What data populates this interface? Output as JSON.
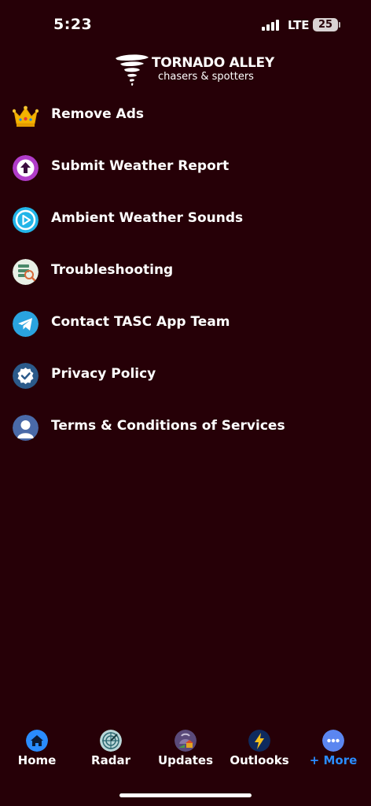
{
  "status_bar": {
    "time": "5:23",
    "network": "LTE",
    "battery": "25"
  },
  "logo": {
    "title": "TORNADO ALLEY",
    "subtitle": "chasers & spotters"
  },
  "menu": {
    "items": [
      {
        "label": "Remove Ads",
        "icon": "crown-icon"
      },
      {
        "label": "Submit Weather Report",
        "icon": "upload-arrow-icon"
      },
      {
        "label": "Ambient Weather Sounds",
        "icon": "play-icon"
      },
      {
        "label": "Troubleshooting",
        "icon": "troubleshoot-icon"
      },
      {
        "label": "Contact TASC App Team",
        "icon": "telegram-icon"
      },
      {
        "label": "Privacy Policy",
        "icon": "verified-check-icon"
      },
      {
        "label": "Terms & Conditions of Services",
        "icon": "user-icon"
      }
    ]
  },
  "tab_bar": {
    "tabs": [
      {
        "label": "Home",
        "icon": "home-icon"
      },
      {
        "label": "Radar",
        "icon": "radar-icon"
      },
      {
        "label": "Updates",
        "icon": "updates-icon"
      },
      {
        "label": "Outlooks",
        "icon": "lightning-icon"
      },
      {
        "label": "+ More",
        "icon": "more-dots-icon",
        "active": true
      }
    ],
    "active_color": "#2a8cff"
  },
  "colors": {
    "background": "#260007",
    "text": "#ffffff",
    "accent": "#2a8cff"
  }
}
